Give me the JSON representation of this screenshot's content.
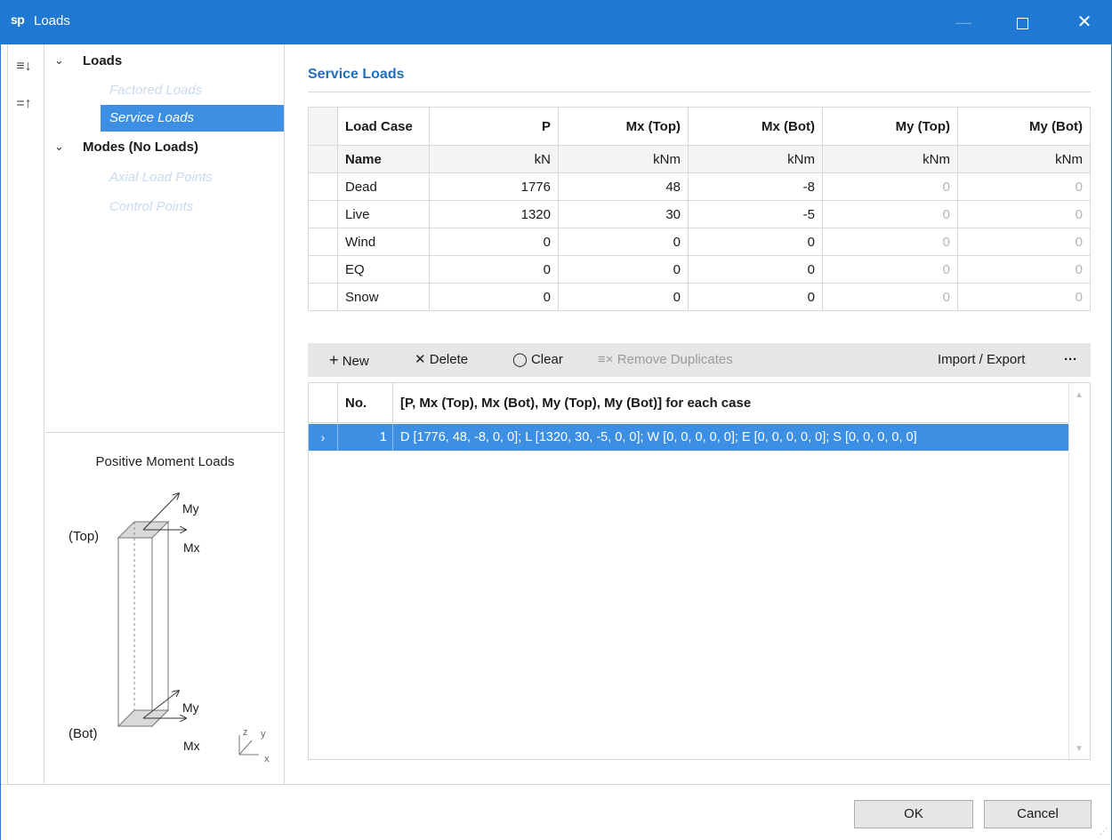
{
  "window": {
    "title": "Loads",
    "logo": "sp",
    "minimize_icon": "minimize-icon",
    "maximize_icon": "maximize-icon",
    "close_icon": "close-icon"
  },
  "toolstrip": {
    "expand_icon": "expand-all-icon",
    "collapse_icon": "collapse-all-icon"
  },
  "tree": {
    "loads": "Loads",
    "factored_loads": "Factored Loads",
    "service_loads": "Service Loads",
    "modes": "Modes (No Loads)",
    "axial_load_points": "Axial Load Points",
    "control_points": "Control Points",
    "selected": "Service Loads"
  },
  "diagram": {
    "title": "Positive Moment Loads",
    "top_label": "(Top)",
    "bot_label": "(Bot)",
    "my_top": "My",
    "mx_top": "Mx",
    "my_bot": "My",
    "mx_bot": "Mx",
    "axis_z": "z",
    "axis_y": "y",
    "axis_x": "x"
  },
  "main": {
    "heading": "Service Loads",
    "table": {
      "headers": [
        "Load Case",
        "P",
        "Mx (Top)",
        "Mx (Bot)",
        "My (Top)",
        "My (Bot)"
      ],
      "units": [
        "Name",
        "kN",
        "kNm",
        "kNm",
        "kNm",
        "kNm"
      ],
      "rows": [
        [
          "Dead",
          "1776",
          "48",
          "-8",
          "0",
          "0"
        ],
        [
          "Live",
          "1320",
          "30",
          "-5",
          "0",
          "0"
        ],
        [
          "Wind",
          "0",
          "0",
          "0",
          "0",
          "0"
        ],
        [
          "EQ",
          "0",
          "0",
          "0",
          "0",
          "0"
        ],
        [
          "Snow",
          "0",
          "0",
          "0",
          "0",
          "0"
        ]
      ]
    },
    "toolbar": {
      "new_label": "New",
      "delete_label": "Delete",
      "clear_label": "Clear",
      "remove_duplicates_label": "Remove Duplicates",
      "import_export_label": "Import / Export",
      "more_label": "···"
    },
    "list": {
      "col_no": "No.",
      "col_desc": "[P, Mx (Top), Mx (Bot), My (Top), My (Bot)] for each case",
      "rows": [
        {
          "no": "1",
          "value": "D [1776, 48, -8, 0, 0]; L [1320, 30, -5, 0, 0]; W [0, 0, 0, 0, 0]; E [0, 0, 0, 0, 0]; S [0, 0, 0, 0, 0]"
        }
      ]
    }
  },
  "footer": {
    "ok_label": "OK",
    "cancel_label": "Cancel"
  },
  "colors": {
    "accent": "#1f78d1",
    "selection": "#3d8fe3",
    "heading": "#1f6fbf"
  }
}
